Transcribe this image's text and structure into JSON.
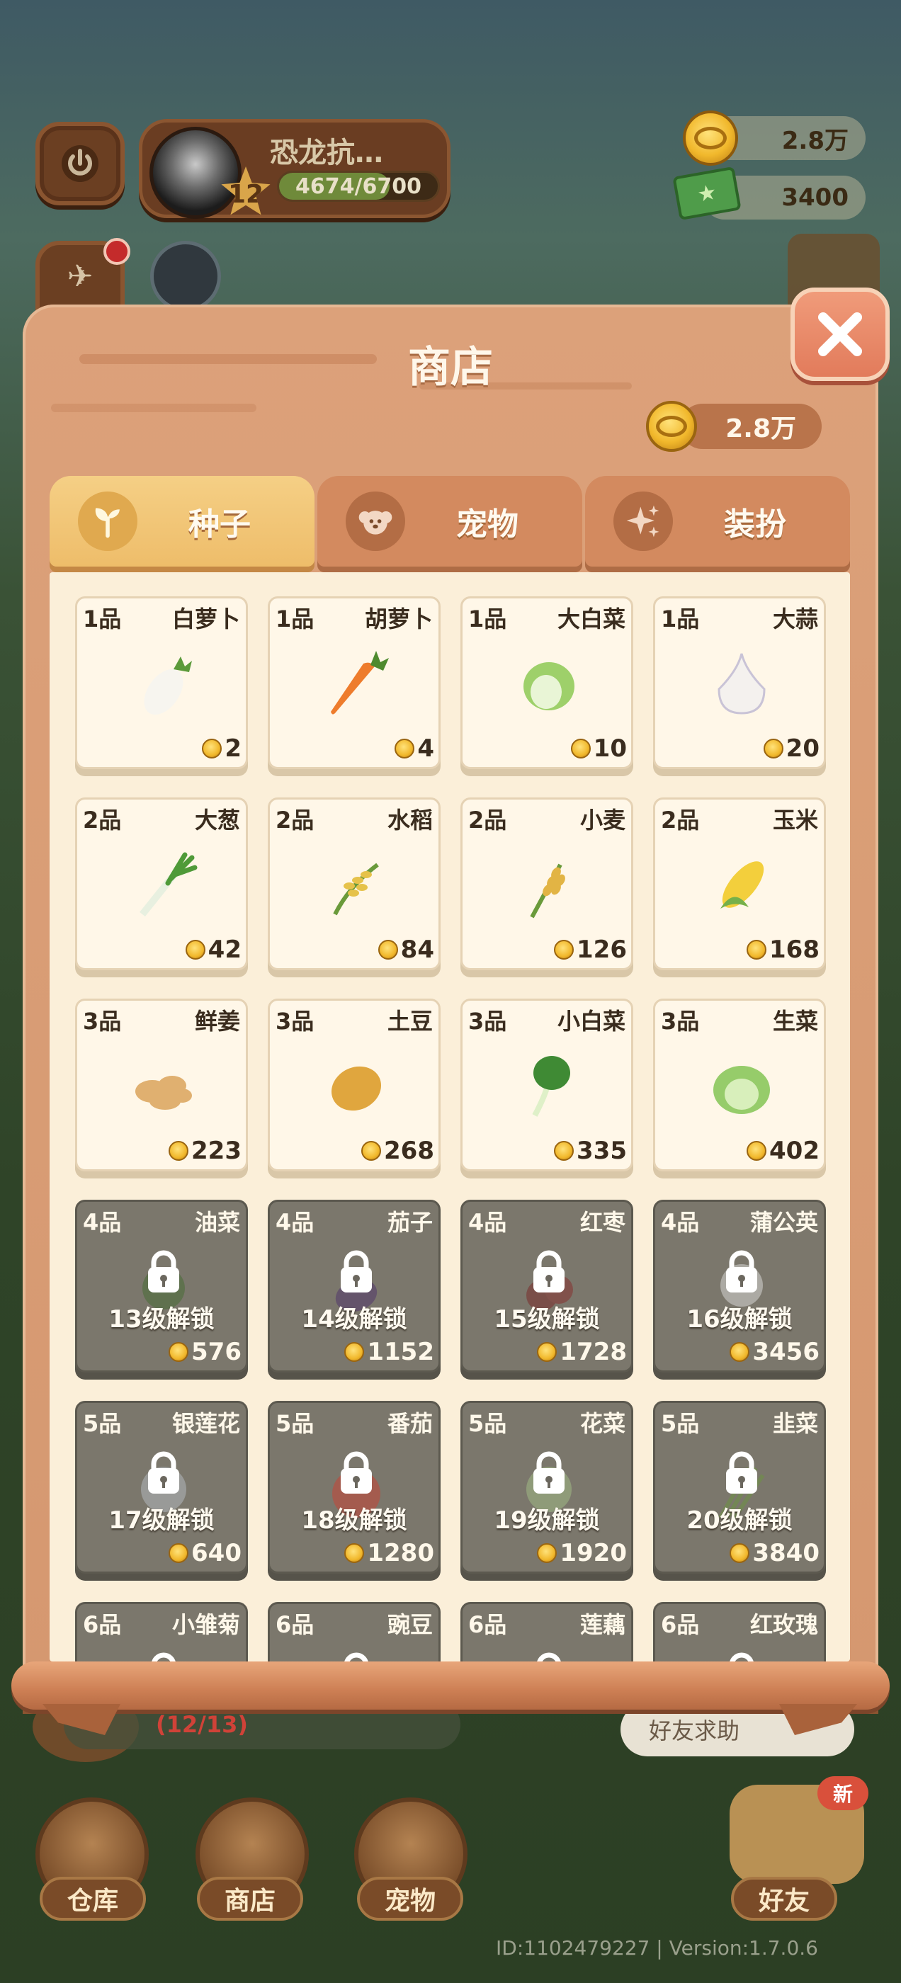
{
  "player": {
    "name": "恐龙抗…",
    "level": "12",
    "exp_text": "4674/6700",
    "exp_progress": 0.6976
  },
  "currencies": {
    "gold": "2.8万",
    "cash": "3400"
  },
  "shop": {
    "title": "商店",
    "coins": "2.8万",
    "tabs": [
      {
        "label": "种子",
        "icon": "sprout-icon",
        "active": true
      },
      {
        "label": "宠物",
        "icon": "dog-icon",
        "active": false
      },
      {
        "label": "装扮",
        "icon": "sparkle-icon",
        "active": false
      }
    ],
    "seeds": [
      {
        "grade": "1品",
        "name": "白萝卜",
        "price": "2",
        "crop": "white-radish",
        "locked": false,
        "unlock": ""
      },
      {
        "grade": "1品",
        "name": "胡萝卜",
        "price": "4",
        "crop": "carrot",
        "locked": false,
        "unlock": ""
      },
      {
        "grade": "1品",
        "name": "大白菜",
        "price": "10",
        "crop": "napa-cabbage",
        "locked": false,
        "unlock": ""
      },
      {
        "grade": "1品",
        "name": "大蒜",
        "price": "20",
        "crop": "garlic",
        "locked": false,
        "unlock": ""
      },
      {
        "grade": "2品",
        "name": "大葱",
        "price": "42",
        "crop": "scallion",
        "locked": false,
        "unlock": ""
      },
      {
        "grade": "2品",
        "name": "水稻",
        "price": "84",
        "crop": "rice",
        "locked": false,
        "unlock": ""
      },
      {
        "grade": "2品",
        "name": "小麦",
        "price": "126",
        "crop": "wheat",
        "locked": false,
        "unlock": ""
      },
      {
        "grade": "2品",
        "name": "玉米",
        "price": "168",
        "crop": "corn",
        "locked": false,
        "unlock": ""
      },
      {
        "grade": "3品",
        "name": "鲜姜",
        "price": "223",
        "crop": "ginger",
        "locked": false,
        "unlock": ""
      },
      {
        "grade": "3品",
        "name": "土豆",
        "price": "268",
        "crop": "potato",
        "locked": false,
        "unlock": ""
      },
      {
        "grade": "3品",
        "name": "小白菜",
        "price": "335",
        "crop": "bok-choy",
        "locked": false,
        "unlock": ""
      },
      {
        "grade": "3品",
        "name": "生菜",
        "price": "402",
        "crop": "lettuce",
        "locked": false,
        "unlock": ""
      },
      {
        "grade": "4品",
        "name": "油菜",
        "price": "576",
        "crop": "rapeseed",
        "locked": true,
        "unlock": "13级解锁"
      },
      {
        "grade": "4品",
        "name": "茄子",
        "price": "1152",
        "crop": "eggplant",
        "locked": true,
        "unlock": "14级解锁"
      },
      {
        "grade": "4品",
        "name": "红枣",
        "price": "1728",
        "crop": "jujube",
        "locked": true,
        "unlock": "15级解锁"
      },
      {
        "grade": "4品",
        "name": "蒲公英",
        "price": "3456",
        "crop": "dandelion",
        "locked": true,
        "unlock": "16级解锁"
      },
      {
        "grade": "5品",
        "name": "银莲花",
        "price": "640",
        "crop": "anemone",
        "locked": true,
        "unlock": "17级解锁"
      },
      {
        "grade": "5品",
        "name": "番茄",
        "price": "1280",
        "crop": "tomato",
        "locked": true,
        "unlock": "18级解锁"
      },
      {
        "grade": "5品",
        "name": "花菜",
        "price": "1920",
        "crop": "cauliflower",
        "locked": true,
        "unlock": "19级解锁"
      },
      {
        "grade": "5品",
        "name": "韭菜",
        "price": "3840",
        "crop": "chives",
        "locked": true,
        "unlock": "20级解锁"
      },
      {
        "grade": "6品",
        "name": "小雏菊",
        "price": "",
        "crop": "daisy",
        "locked": true,
        "unlock": ""
      },
      {
        "grade": "6品",
        "name": "豌豆",
        "price": "",
        "crop": "pea",
        "locked": true,
        "unlock": ""
      },
      {
        "grade": "6品",
        "name": "莲藕",
        "price": "",
        "crop": "lotus-root",
        "locked": true,
        "unlock": ""
      },
      {
        "grade": "6品",
        "name": "红玫瑰",
        "price": "",
        "crop": "red-rose",
        "locked": true,
        "unlock": ""
      }
    ]
  },
  "task": {
    "progress_text": "(12/13)"
  },
  "friend_help_label": "好友求助",
  "nav": [
    {
      "label": "仓库",
      "name": "warehouse"
    },
    {
      "label": "商店",
      "name": "shop"
    },
    {
      "label": "宠物",
      "name": "pets"
    },
    {
      "label": "好友",
      "name": "friends"
    }
  ],
  "new_badge": "新",
  "version_text": "ID:1102479227 | Version:1.7.0.6",
  "colors": {
    "panel": "#dca17a",
    "tab_active": "#f5cf85",
    "card_bg": "#fff7e8",
    "card_locked": "#7b776c",
    "close_button": "#e27b5b"
  }
}
